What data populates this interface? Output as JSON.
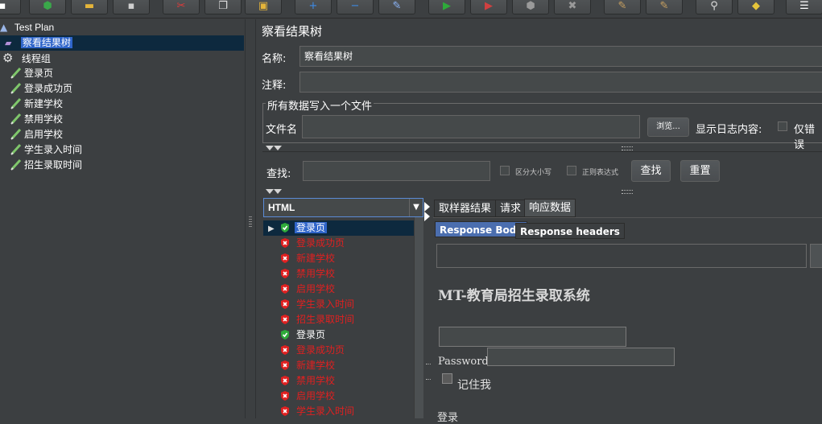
{
  "toolbar": {
    "buttons": [
      {
        "name": "new-icon",
        "glyph": "▪",
        "color": "#ffffff"
      },
      {
        "name": "templates-icon",
        "glyph": "⬢",
        "color": "#3aa84a"
      },
      {
        "name": "open-icon",
        "glyph": "▬",
        "color": "#e5b53a"
      },
      {
        "name": "save-icon",
        "glyph": "▪",
        "color": "#cfcfcf"
      },
      {
        "name": "cut-icon",
        "glyph": "✂",
        "color": "#e03a3a"
      },
      {
        "name": "copy-icon",
        "glyph": "❐",
        "color": "#e0e0e0"
      },
      {
        "name": "paste-icon",
        "glyph": "▣",
        "color": "#e5b53a"
      },
      {
        "name": "expand-icon",
        "glyph": "+",
        "color": "#3d8ce8"
      },
      {
        "name": "collapse-icon",
        "glyph": "−",
        "color": "#3d8ce8"
      },
      {
        "name": "toggle-icon",
        "glyph": "✎",
        "color": "#8ab4f8"
      },
      {
        "name": "start-icon",
        "glyph": "▶",
        "color": "#2eaa3a"
      },
      {
        "name": "start-no-pause-icon",
        "glyph": "▶",
        "color": "#d04040"
      },
      {
        "name": "stop-icon",
        "glyph": "⬢",
        "color": "#9a9a9a"
      },
      {
        "name": "shutdown-icon",
        "glyph": "✖",
        "color": "#9a9a9a"
      },
      {
        "name": "clear-icon",
        "glyph": "✎",
        "color": "#c8a060"
      },
      {
        "name": "clear-all-icon",
        "glyph": "✎",
        "color": "#c8a060"
      },
      {
        "name": "search-icon",
        "glyph": "⚲",
        "color": "#dddddd"
      },
      {
        "name": "reset-search-icon",
        "glyph": "◆",
        "color": "#e5c53a"
      },
      {
        "name": "function-helper-icon",
        "glyph": "☰",
        "color": "#ffffff"
      }
    ]
  },
  "tree": {
    "root": "Test Plan",
    "listener": "察看结果树",
    "thread_group": "线程组",
    "samplers": [
      "登录页",
      "登录成功页",
      "新建学校",
      "禁用学校",
      "启用学校",
      "学生录入时间",
      "招生录取时间"
    ]
  },
  "panel": {
    "title": "察看结果树",
    "name_label": "名称:",
    "name_value": "察看结果树",
    "comment_label": "注释:",
    "comment_value": "",
    "file_section_title": "所有数据写入一个文件",
    "filename_label": "文件名",
    "filename_value": "",
    "browse_button": "浏览...",
    "log_label": "显示日志内容:",
    "errors_only": "仅错误"
  },
  "search": {
    "label": "查找:",
    "value": "",
    "case_sensitive": "区分大小写",
    "regex": "正则表达式",
    "find_button": "查找",
    "reset_button": "重置"
  },
  "renderer": {
    "selected": "HTML"
  },
  "results": [
    {
      "label": "登录页",
      "status": "ok",
      "selected": true,
      "expander": true
    },
    {
      "label": "登录成功页",
      "status": "error"
    },
    {
      "label": "新建学校",
      "status": "error"
    },
    {
      "label": "禁用学校",
      "status": "error"
    },
    {
      "label": "启用学校",
      "status": "error"
    },
    {
      "label": "学生录入时间",
      "status": "error"
    },
    {
      "label": "招生录取时间",
      "status": "error"
    },
    {
      "label": "登录页",
      "status": "ok"
    },
    {
      "label": "登录成功页",
      "status": "error"
    },
    {
      "label": "新建学校",
      "status": "error"
    },
    {
      "label": "禁用学校",
      "status": "error"
    },
    {
      "label": "启用学校",
      "status": "error"
    },
    {
      "label": "学生录入时间",
      "status": "error"
    }
  ],
  "tabs": {
    "sampler_result": "取样器结果",
    "request": "请求",
    "response_data": "响应数据",
    "response_body": "Response Body",
    "response_headers": "Response headers"
  },
  "response": {
    "heading": "MT-教育局招生录取系统",
    "password_label": "Password",
    "remember_me": "记住我",
    "login": "登录"
  },
  "colors": {
    "ok": "#2eaa3a",
    "error": "#e02020",
    "selection": "#2f65ca"
  }
}
